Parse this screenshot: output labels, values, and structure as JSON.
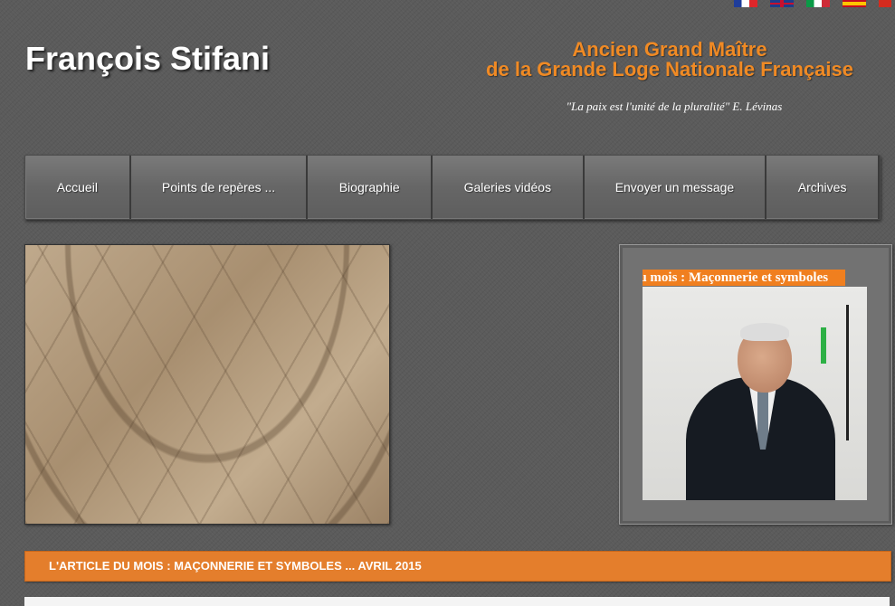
{
  "languages": [
    {
      "code": "fr",
      "icon": "flag-france-icon"
    },
    {
      "code": "en",
      "icon": "flag-uk-icon"
    },
    {
      "code": "it",
      "icon": "flag-italy-icon"
    },
    {
      "code": "es",
      "icon": "flag-spain-icon"
    },
    {
      "code": "ch",
      "icon": "flag-switzerland-icon"
    }
  ],
  "header": {
    "site_name": "François Stifani",
    "tagline_line1": "Ancien Grand Maître",
    "tagline_line2": "de la Grande Loge Nationale Française",
    "quote": "\"La paix est l'unité de la pluralité\" E. Lévinas"
  },
  "nav": {
    "items": [
      {
        "label": "Accueil"
      },
      {
        "label": "Points de repères ..."
      },
      {
        "label": "Biographie"
      },
      {
        "label": "Galeries vidéos"
      },
      {
        "label": "Envoyer un message"
      },
      {
        "label": "Archives"
      }
    ]
  },
  "side_panel": {
    "title": "du mois : Maçonnerie et symboles"
  },
  "article": {
    "title": "L'ARTICLE DU MOIS : MAÇONNERIE ET SYMBOLES ... AVRIL 2015"
  },
  "colors": {
    "accent": "#e47e2c",
    "background": "#5b5b5b",
    "tagline": "#f08a24"
  }
}
